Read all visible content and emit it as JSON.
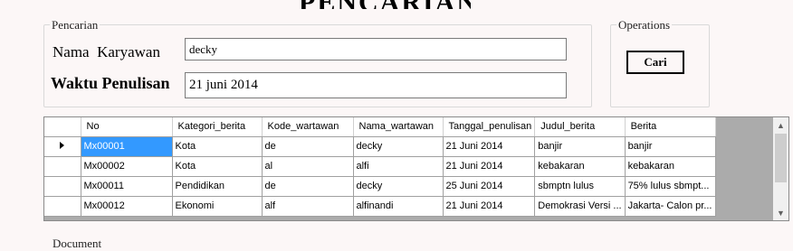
{
  "title": "PENCARIAN",
  "search_group": {
    "legend": "Pencarian",
    "nama_label": "Nama  Karyawan",
    "nama_value": "decky",
    "waktu_label": "Waktu Penulisan",
    "waktu_value": "21 juni 2014"
  },
  "operations_group": {
    "legend": "Operations",
    "cari_label": "Cari"
  },
  "grid": {
    "columns": [
      "No",
      "Kategori_berita",
      "Kode_wartawan",
      "Nama_wartawan",
      "Tanggal_penulisan",
      "Judul_berita",
      "Berita"
    ],
    "rows": [
      [
        "Mx00001",
        "Kota",
        "de",
        "decky",
        "21 Juni 2014",
        "banjir",
        "banjir"
      ],
      [
        "Mx00002",
        "Kota",
        "al",
        "alfi",
        "21 Juni 2014",
        "kebakaran",
        "kebakaran"
      ],
      [
        "Mx00011",
        "Pendidikan",
        "de",
        "decky",
        "25 Juni 2014",
        "sbmptn lulus",
        "75% lulus sbmpt..."
      ],
      [
        "Mx00012",
        "Ekonomi",
        "alf",
        "alfinandi",
        "21 Juni 2014",
        "Demokrasi Versi ...",
        "Jakarta- Calon pr..."
      ]
    ],
    "scroll_up_icon": "▲",
    "scroll_down_icon": "▼"
  },
  "document_group": {
    "legend": "Document"
  }
}
